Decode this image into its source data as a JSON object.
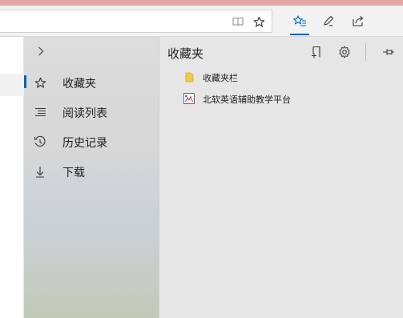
{
  "toolbar": {
    "icons": [
      "reading-view-icon",
      "star-icon",
      "favorites-hub-icon",
      "pen-icon",
      "share-icon"
    ],
    "active_color": "#0063b1"
  },
  "hub": {
    "expand_icon": "chevron-right-icon",
    "nav": [
      {
        "label": "收藏夹",
        "icon": "star-icon",
        "selected": true
      },
      {
        "label": "阅读列表",
        "icon": "reading-list-icon",
        "selected": false
      },
      {
        "label": "历史记录",
        "icon": "history-icon",
        "selected": false
      },
      {
        "label": "下载",
        "icon": "download-icon",
        "selected": false
      }
    ]
  },
  "pane": {
    "title": "收藏夹",
    "icons": [
      "add-to-favorites-icon",
      "settings-gear-icon",
      "pin-icon"
    ],
    "items": [
      {
        "label": "收藏夹栏",
        "icon": "folder-icon"
      },
      {
        "label": "北软英语辅助教学平台",
        "icon": "page-icon"
      }
    ]
  }
}
